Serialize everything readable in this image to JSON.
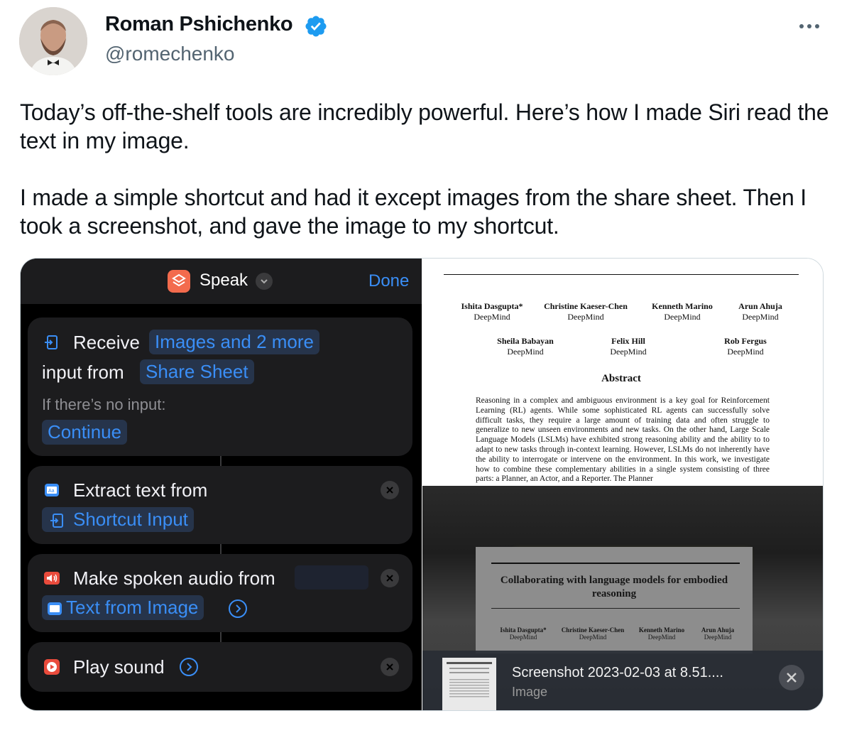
{
  "author": {
    "name": "Roman Pshichenko",
    "handle": "@romechenko",
    "verified_color": "#1d9bf0"
  },
  "tweet": {
    "paragraph1": "Today’s off-the-shelf tools are incredibly powerful. Here’s how I made Siri read the text in my image.",
    "paragraph2": "I made a simple shortcut and had it except images from the share sheet. Then I took a screenshot, and gave the image to my shortcut."
  },
  "shortcut": {
    "title": "Speak",
    "done_label": "Done",
    "receive": {
      "label": "Receive",
      "token": "Images and 2 more",
      "input_from": "input from",
      "source": "Share Sheet",
      "no_input": "If there’s no input:",
      "continue": "Continue"
    },
    "extract": {
      "label": "Extract text from",
      "token": "Shortcut Input"
    },
    "speak": {
      "label": "Make spoken audio from",
      "token": "Text from Image"
    },
    "play": {
      "label": "Play sound"
    }
  },
  "paper": {
    "authors_row1": [
      {
        "name": "Ishita Dasgupta*",
        "org": "DeepMind"
      },
      {
        "name": "Christine Kaeser-Chen",
        "org": "DeepMind"
      },
      {
        "name": "Kenneth Marino",
        "org": "DeepMind"
      },
      {
        "name": "Arun Ahuja",
        "org": "DeepMind"
      }
    ],
    "authors_row2": [
      {
        "name": "Sheila Babayan",
        "org": "DeepMind"
      },
      {
        "name": "Felix Hill",
        "org": "DeepMind"
      },
      {
        "name": "Rob Fergus",
        "org": "DeepMind"
      }
    ],
    "abstract_title": "Abstract",
    "abstract_body": "Reasoning in a complex and ambiguous environment is a key goal for Reinforcement Learning (RL) agents. While some sophisticated RL agents can successfully solve difficult tasks, they require a large amount of training data and often struggle to generalize to new unseen environments and new tasks. On the other hand, Large Scale Language Models (LSLMs) have exhibited strong reasoning ability and the ability to to adapt to new tasks through in-context learning. However, LSLMs do not inherently have the ability to interrogate or intervene on the environment. In this work, we investigate how to combine these complementary abilities in a single system consisting of three parts: a Planner, an Actor, and a Reporter. The Planner"
  },
  "photo": {
    "title": "Collaborating with language models for embodied reasoning",
    "authors": [
      {
        "name": "Ishita Dasgupta*",
        "org": "DeepMind"
      },
      {
        "name": "Christine Kaeser-Chen",
        "org": "DeepMind"
      },
      {
        "name": "Kenneth Marino",
        "org": "DeepMind"
      },
      {
        "name": "Arun Ahuja",
        "org": "DeepMind"
      }
    ]
  },
  "toast": {
    "title": "Screenshot 2023-02-03 at 8.51....",
    "subtitle": "Image"
  }
}
